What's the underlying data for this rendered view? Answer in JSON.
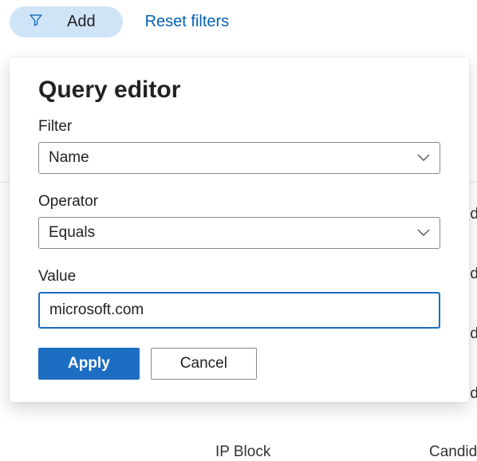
{
  "toolbar": {
    "add_label": "Add",
    "reset_label": "Reset filters"
  },
  "popover": {
    "title": "Query editor",
    "filter_label": "Filter",
    "filter_value": "Name",
    "operator_label": "Operator",
    "operator_value": "Equals",
    "value_label": "Value",
    "value_input": "microsoft.com",
    "apply_label": "Apply",
    "cancel_label": "Cancel"
  },
  "background": {
    "ip_block": "IP Block",
    "candid": "Candid",
    "d": "d"
  }
}
